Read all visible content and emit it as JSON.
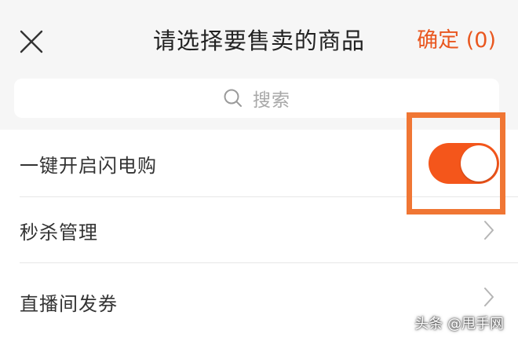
{
  "header": {
    "title": "请选择要售卖的商品",
    "confirm_label": "确定 (0)",
    "close_icon": "close-icon"
  },
  "search": {
    "placeholder": "搜索",
    "icon": "search-icon"
  },
  "settings": {
    "flash_buy": {
      "label": "一键开启闪电购",
      "enabled": true
    },
    "seckill": {
      "label": "秒杀管理"
    },
    "live_coupon": {
      "label": "直播间发券"
    }
  },
  "colors": {
    "accent": "#f4561b",
    "confirm_text": "#e9571f",
    "highlight": "#f07634"
  },
  "watermark": {
    "text": "头条 @甩手网"
  }
}
